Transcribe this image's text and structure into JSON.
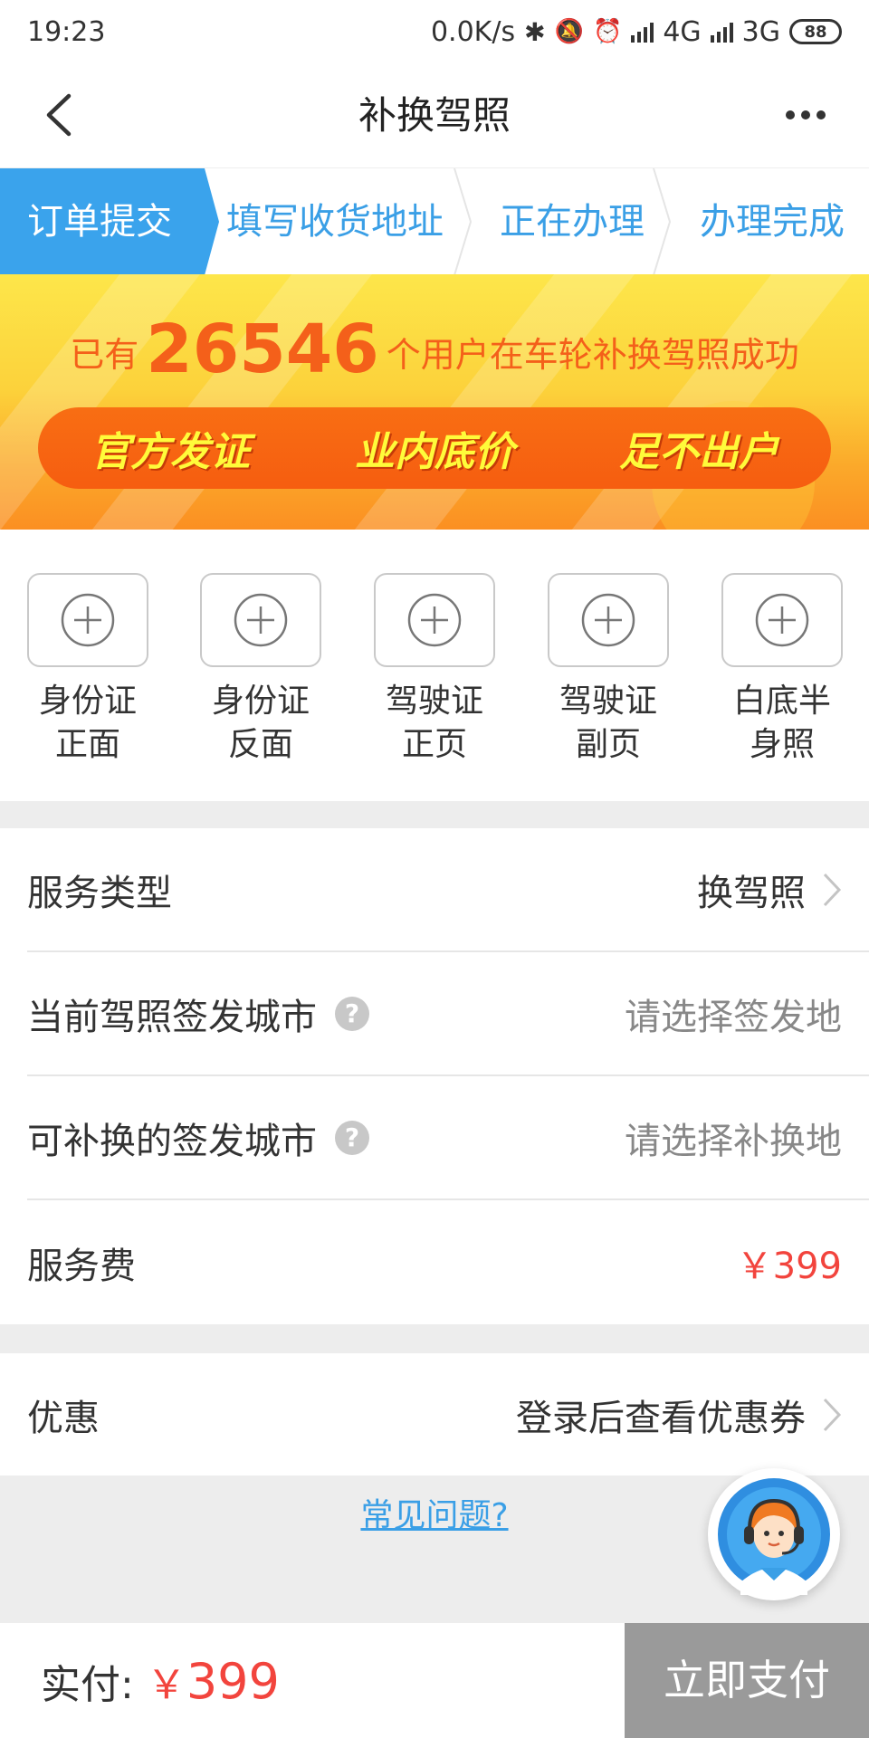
{
  "status_bar": {
    "time": "19:23",
    "net_speed": "0.0K/s",
    "network1": "4G",
    "network2": "3G",
    "battery": "88"
  },
  "nav": {
    "title": "补换驾照"
  },
  "steps": [
    {
      "label": "订单提交"
    },
    {
      "label": "填写收货地址"
    },
    {
      "label": "正在办理"
    },
    {
      "label": "办理完成"
    }
  ],
  "banner": {
    "prefix": "已有",
    "count": "26546",
    "suffix": "个用户在车轮补换驾照成功",
    "features": [
      "官方发证",
      "业内底价",
      "足不出户"
    ]
  },
  "uploads": [
    {
      "line1": "身份证",
      "line2": "正面"
    },
    {
      "line1": "身份证",
      "line2": "反面"
    },
    {
      "line1": "驾驶证",
      "line2": "正页"
    },
    {
      "line1": "驾驶证",
      "line2": "副页"
    },
    {
      "line1": "白底半",
      "line2": "身照"
    }
  ],
  "form": {
    "service_type": {
      "label": "服务类型",
      "value": "换驾照"
    },
    "current_city": {
      "label": "当前驾照签发城市",
      "placeholder": "请选择签发地"
    },
    "target_city": {
      "label": "可补换的签发城市",
      "placeholder": "请选择补换地"
    },
    "fee": {
      "label": "服务费",
      "value": "￥399"
    }
  },
  "discount": {
    "label": "优惠",
    "value": "登录后查看优惠券"
  },
  "faq": "常见问题?",
  "bottom": {
    "paid_label": "实付:",
    "currency": "￥",
    "amount": "399",
    "pay_button": "立即支付"
  },
  "colors": {
    "accent_blue": "#3aa3ec",
    "price_red": "#f2443d",
    "banner_orange": "#f65d10",
    "disabled_gray": "#9a9a9a"
  }
}
